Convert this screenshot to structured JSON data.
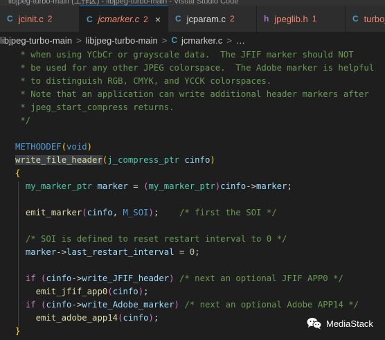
{
  "window": {
    "title": "libjpeg-turbo-main (工作区) - libjpeg-turbo-main - Visual Studio Code"
  },
  "tabs": [
    {
      "icon": "C",
      "name": "jcinit.c",
      "count": "2",
      "error": true,
      "active": false
    },
    {
      "icon": "C",
      "name": "jcmarker.c",
      "count": "2",
      "error": true,
      "active": true,
      "close": "×"
    },
    {
      "icon": "C",
      "name": "jcparam.c",
      "count": "2",
      "error": false,
      "active": false
    },
    {
      "icon": "h",
      "name": "jpeglib.h",
      "count": "1",
      "error": true,
      "active": false
    },
    {
      "icon": "C",
      "name": "turboj",
      "count": "",
      "error": true,
      "active": false
    }
  ],
  "breadcrumb": {
    "items": [
      "libjpeg-turbo-main",
      "libjpeg-turbo-main",
      "jcmarker.c",
      "…"
    ],
    "file_icon": "C",
    "separator": ">"
  },
  "code": {
    "comment_lines": [
      " * when using YCbCr or grayscale data.  The JFIF marker should NOT",
      " * be used for any other JPEG colorspace.  The Adobe marker is helpful",
      " * to distinguish RGB, CMYK, and YCCK colorspaces.",
      " * Note that an application can write additional header markers after",
      " * jpeg_start_compress returns.",
      " */"
    ],
    "macro": "METHODDEF",
    "ret_type": "void",
    "func_name": "write_file_header",
    "param_type": "j_compress_ptr",
    "param_name": "cinfo",
    "open_brace": "{",
    "close_brace": "}",
    "var_type": "my_marker_ptr",
    "var_name": "marker",
    "cast_type": "my_marker_ptr",
    "field_marker": "marker",
    "emit_marker": "emit_marker",
    "m_soi": "M_SOI",
    "soi_comment": "/* first the SOI */",
    "reset_comment": "/* SOI is defined to reset restart interval to 0 */",
    "last_restart": "last_restart_interval",
    "zero": "0",
    "kw_if": "if",
    "write_jfif": "write_JFIF_header",
    "jfif_comment": "/* next an optional JFIF APP0 */",
    "emit_jfif": "emit_jfif_app0",
    "write_adobe": "write_Adobe_marker",
    "adobe_comment": "/* next an optional Adobe APP14 */",
    "emit_adobe": "emit_adobe_app14"
  },
  "watermark": {
    "text": "MediaStack",
    "icon": "wechat-icon"
  },
  "colors": {
    "accent": "#007acc",
    "error": "#f48771",
    "c_icon": "#519aba",
    "h_icon": "#a074c4"
  }
}
